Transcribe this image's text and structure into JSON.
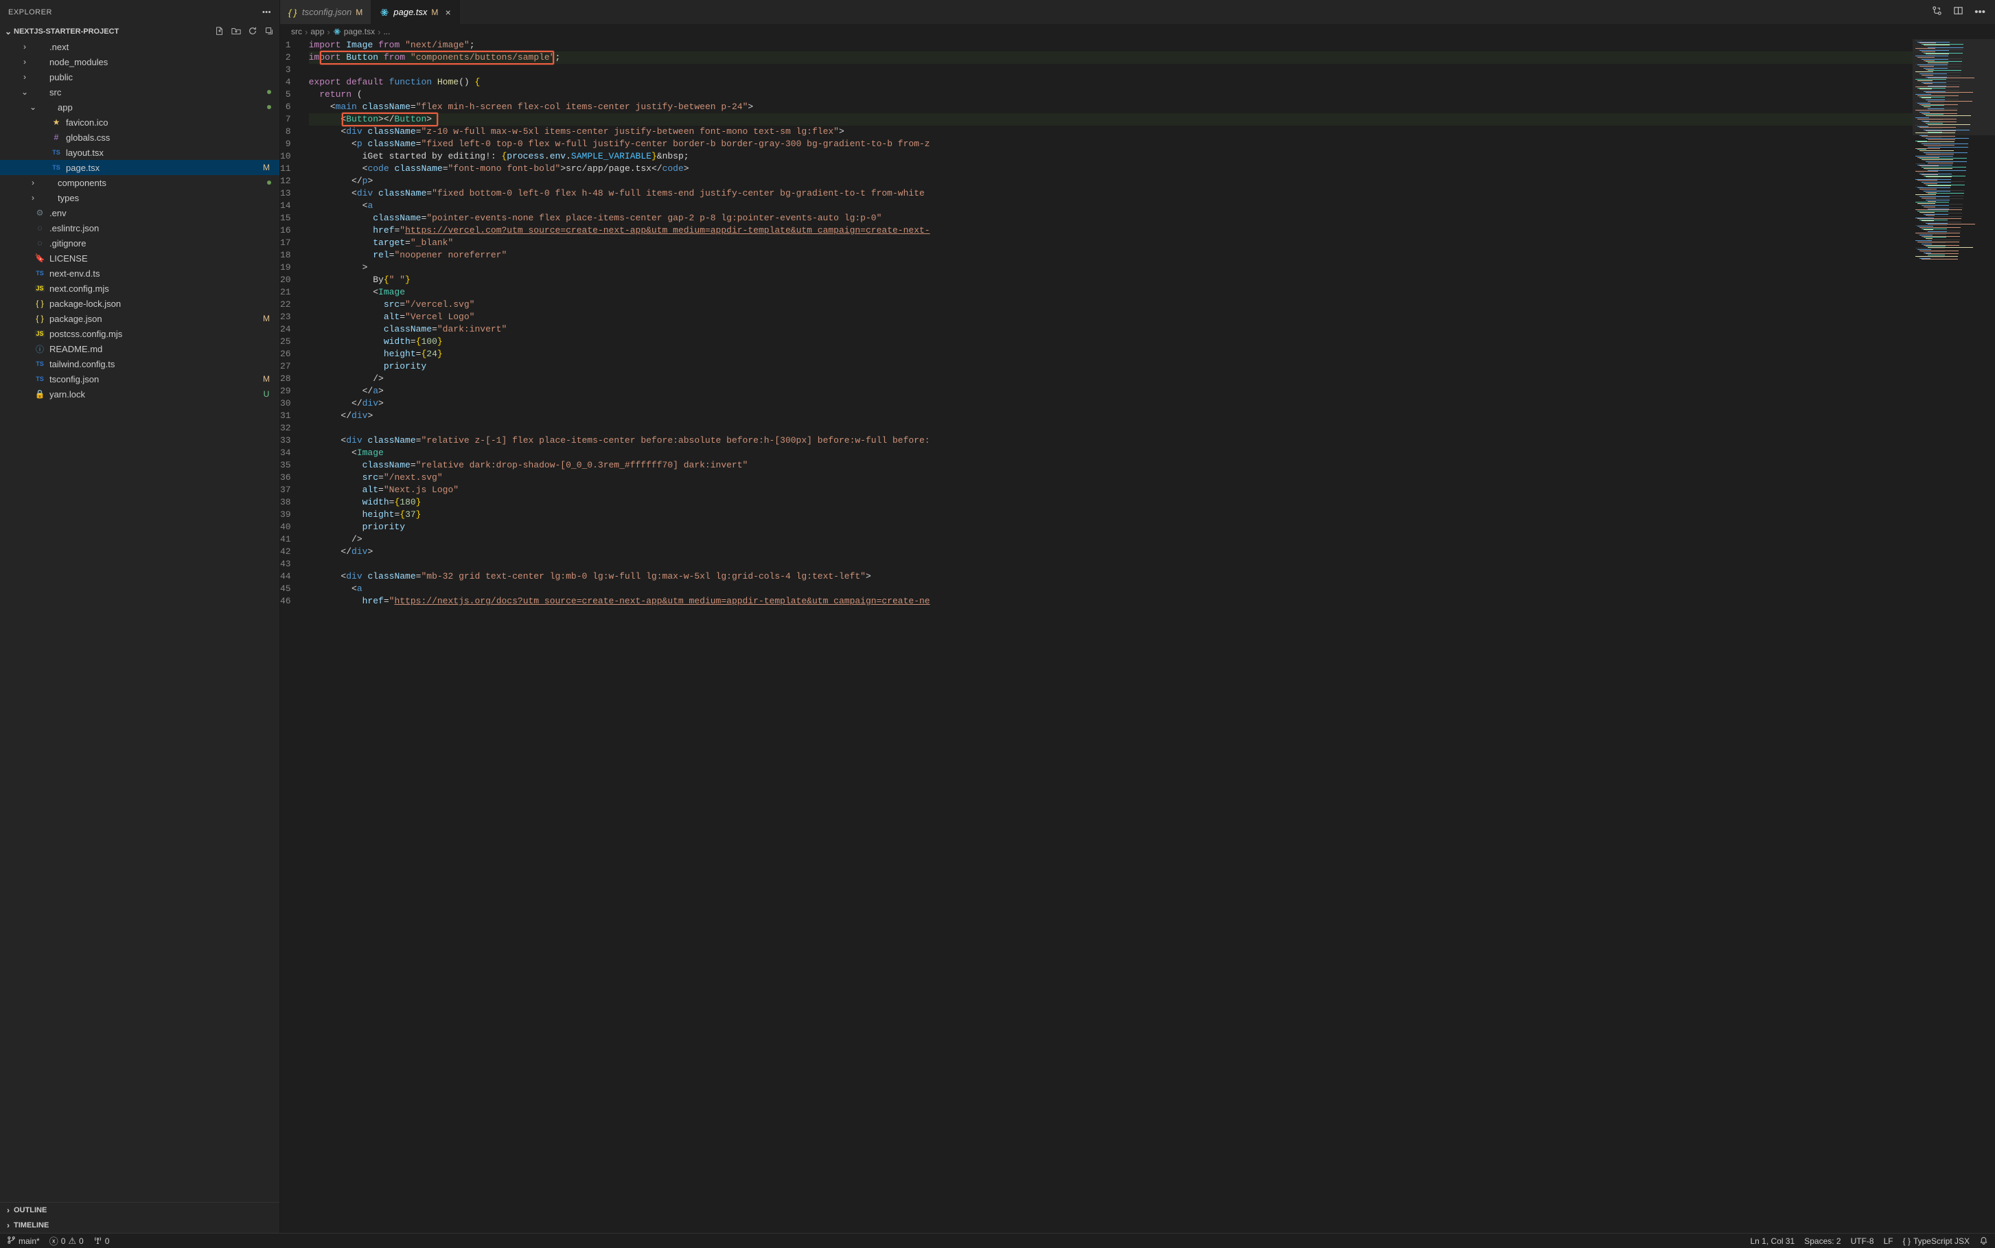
{
  "explorer": {
    "title": "EXPLORER",
    "project_name": "NEXTJS-STARTER-PROJECT",
    "tree": [
      {
        "depth": 1,
        "twisty": "›",
        "icon": "folder",
        "name": ".next"
      },
      {
        "depth": 1,
        "twisty": "›",
        "icon": "folder",
        "name": "node_modules"
      },
      {
        "depth": 1,
        "twisty": "›",
        "icon": "folder",
        "name": "public"
      },
      {
        "depth": 1,
        "twisty": "⌄",
        "icon": "folder",
        "name": "src",
        "dot": true
      },
      {
        "depth": 2,
        "twisty": "⌄",
        "icon": "folder",
        "name": "app",
        "dot": true
      },
      {
        "depth": 3,
        "twisty": "",
        "icon": "star",
        "name": "favicon.ico"
      },
      {
        "depth": 3,
        "twisty": "",
        "icon": "hash",
        "name": "globals.css"
      },
      {
        "depth": 3,
        "twisty": "",
        "icon": "ts",
        "name": "layout.tsx"
      },
      {
        "depth": 3,
        "twisty": "",
        "icon": "ts",
        "name": "page.tsx",
        "selected": true,
        "badge": "M"
      },
      {
        "depth": 2,
        "twisty": "›",
        "icon": "folder",
        "name": "components",
        "dot": true
      },
      {
        "depth": 2,
        "twisty": "›",
        "icon": "folder",
        "name": "types"
      },
      {
        "depth": 1,
        "twisty": "",
        "icon": "gear",
        "name": ".env"
      },
      {
        "depth": 1,
        "twisty": "",
        "icon": "env",
        "name": ".eslintrc.json"
      },
      {
        "depth": 1,
        "twisty": "",
        "icon": "env",
        "name": ".gitignore"
      },
      {
        "depth": 1,
        "twisty": "",
        "icon": "lic",
        "name": "LICENSE"
      },
      {
        "depth": 1,
        "twisty": "",
        "icon": "ts",
        "name": "next-env.d.ts"
      },
      {
        "depth": 1,
        "twisty": "",
        "icon": "js",
        "name": "next.config.mjs"
      },
      {
        "depth": 1,
        "twisty": "",
        "icon": "json",
        "name": "package-lock.json"
      },
      {
        "depth": 1,
        "twisty": "",
        "icon": "json",
        "name": "package.json",
        "badge": "M"
      },
      {
        "depth": 1,
        "twisty": "",
        "icon": "js",
        "name": "postcss.config.mjs"
      },
      {
        "depth": 1,
        "twisty": "",
        "icon": "info",
        "name": "README.md"
      },
      {
        "depth": 1,
        "twisty": "",
        "icon": "ts",
        "name": "tailwind.config.ts"
      },
      {
        "depth": 1,
        "twisty": "",
        "icon": "ts",
        "name": "tsconfig.json",
        "badge": "M"
      },
      {
        "depth": 1,
        "twisty": "",
        "icon": "lock",
        "name": "yarn.lock",
        "badge": "U"
      }
    ],
    "bottom_sections": [
      "OUTLINE",
      "TIMELINE"
    ]
  },
  "tabs": [
    {
      "icon": "ts",
      "label": "tsconfig.json",
      "mod": "M",
      "active": false,
      "close": false
    },
    {
      "icon": "ts",
      "label": "page.tsx",
      "mod": "M",
      "active": true,
      "close": true
    }
  ],
  "breadcrumbs": [
    "src",
    "app",
    "page.tsx",
    "..."
  ],
  "code_lines_count": 46,
  "status": {
    "branch": "main*",
    "errors": "0",
    "warnings": "0",
    "ports": "0",
    "cursor": "Ln 1, Col 31",
    "spaces": "Spaces: 2",
    "encoding": "UTF-8",
    "eol": "LF",
    "lang": "TypeScript JSX",
    "notif": "notif"
  },
  "colors": {
    "bg": "#1e1e1e",
    "sidebar": "#252526",
    "selection": "#04395e",
    "highlight_box": "#e85e40",
    "badge_M": "#e2c08d",
    "badge_U": "#73c991"
  }
}
